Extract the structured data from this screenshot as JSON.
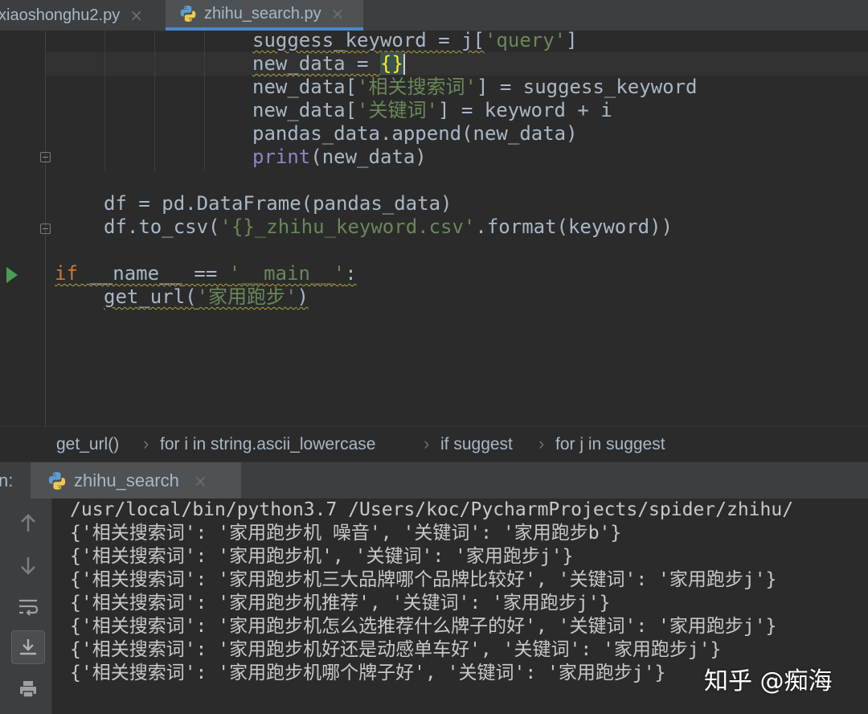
{
  "tabs": [
    {
      "label": "xiaoshonghu2.py",
      "close": "×",
      "active": false
    },
    {
      "label": "zhihu_search.py",
      "close": "×",
      "active": true
    }
  ],
  "editor": {
    "lines": [
      {
        "indent": "suggess_keyword = j[",
        "str": "'query'",
        "tail": "]"
      },
      {
        "text": "new_data = ",
        "brace": "{}"
      },
      {
        "a": "new_data[",
        "str": "'相关搜索词'",
        "b": "] = suggess_keyword"
      },
      {
        "a": "new_data[",
        "str": "'关键词'",
        "b": "] = keyword + i"
      },
      {
        "text": "pandas_data.append(new_data)"
      },
      {
        "builtin": "print",
        "rest": "(new_data)"
      },
      {
        "text": "df = pd.DataFrame(pandas_data)"
      },
      {
        "a": "df.to_csv(",
        "str": "'{}_zhihu_keyword.csv'",
        "b": ".format(keyword))"
      },
      {
        "kw": "if",
        "sp": " ",
        "dunder": "__name__",
        "op": " == ",
        "str": "'__main__'",
        "tail": ":"
      },
      {
        "a": "get_url(",
        "str": "'家用跑步'",
        "b": ")"
      }
    ]
  },
  "breadcrumb": [
    "get_url()",
    "for i in string.ascii_lowercase",
    "if suggest",
    "for j in suggest"
  ],
  "breadcrumb_sep": "›",
  "run": {
    "label": "n:",
    "tab_label": "zhihu_search",
    "tab_close": "×"
  },
  "console": {
    "lines": [
      "/usr/local/bin/python3.7 /Users/koc/PycharmProjects/spider/zhihu/",
      "{'相关搜索词': '家用跑步机 噪音', '关键词': '家用跑步b'}",
      "{'相关搜索词': '家用跑步机', '关键词': '家用跑步j'}",
      "{'相关搜索词': '家用跑步机三大品牌哪个品牌比较好', '关键词': '家用跑步j'}",
      "{'相关搜索词': '家用跑步机推荐', '关键词': '家用跑步j'}",
      "{'相关搜索词': '家用跑步机怎么选推荐什么牌子的好', '关键词': '家用跑步j'}",
      "{'相关搜索词': '家用跑步机好还是动感单车好', '关键词': '家用跑步j'}",
      "{'相关搜索词': '家用跑步机哪个牌子好', '关键词': '家用跑步j'}"
    ],
    "tools": [
      "arrow-up-icon",
      "arrow-down-icon",
      "soft-wrap-icon",
      "scroll-to-end-icon",
      "print-icon"
    ]
  },
  "watermark": "知乎 @痴海",
  "colors": {
    "background": "#2b2b2b",
    "keyword": "#cc7832",
    "string": "#6a8759",
    "builtin": "#8888c6",
    "dunder": "#b200b2",
    "text": "#a9b7c6",
    "accent": "#4a88c7"
  }
}
